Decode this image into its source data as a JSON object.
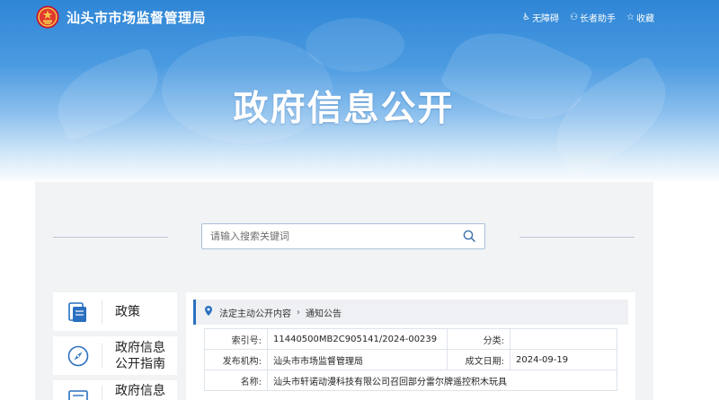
{
  "header": {
    "site_title": "汕头市市场监督管理局",
    "links": [
      {
        "label": "无障碍",
        "icon": "accessibility-icon"
      },
      {
        "label": "长者助手",
        "icon": "elder-icon"
      },
      {
        "label": "收藏",
        "icon": "star-icon"
      }
    ]
  },
  "hero": {
    "title": "政府信息公开"
  },
  "search": {
    "placeholder": "请输入搜索关键词"
  },
  "nav": {
    "items": [
      {
        "label": "政策",
        "icon": "book-icon"
      },
      {
        "label": "政府信息公开指南",
        "icon": "compass-icon"
      },
      {
        "label": "政府信息",
        "icon": "document-icon"
      }
    ]
  },
  "breadcrumb": {
    "items": [
      "法定主动公开内容",
      "通知公告"
    ]
  },
  "info": {
    "index_label": "索引号:",
    "index_value": "11440500MB2C905141/2024-00239",
    "category_label": "分类:",
    "category_value": "",
    "publisher_label": "发布机构:",
    "publisher_value": "汕头市市场监督管理局",
    "date_label": "成文日期:",
    "date_value": "2024-09-19",
    "name_label": "名称:",
    "name_value": "汕头市轩诺动漫科技有限公司召回部分雷尔牌遥控积木玩具"
  },
  "colors": {
    "banner_top": "#2f86d6",
    "accent": "#2a6fc0",
    "panel_bg": "#f2f3f5"
  }
}
